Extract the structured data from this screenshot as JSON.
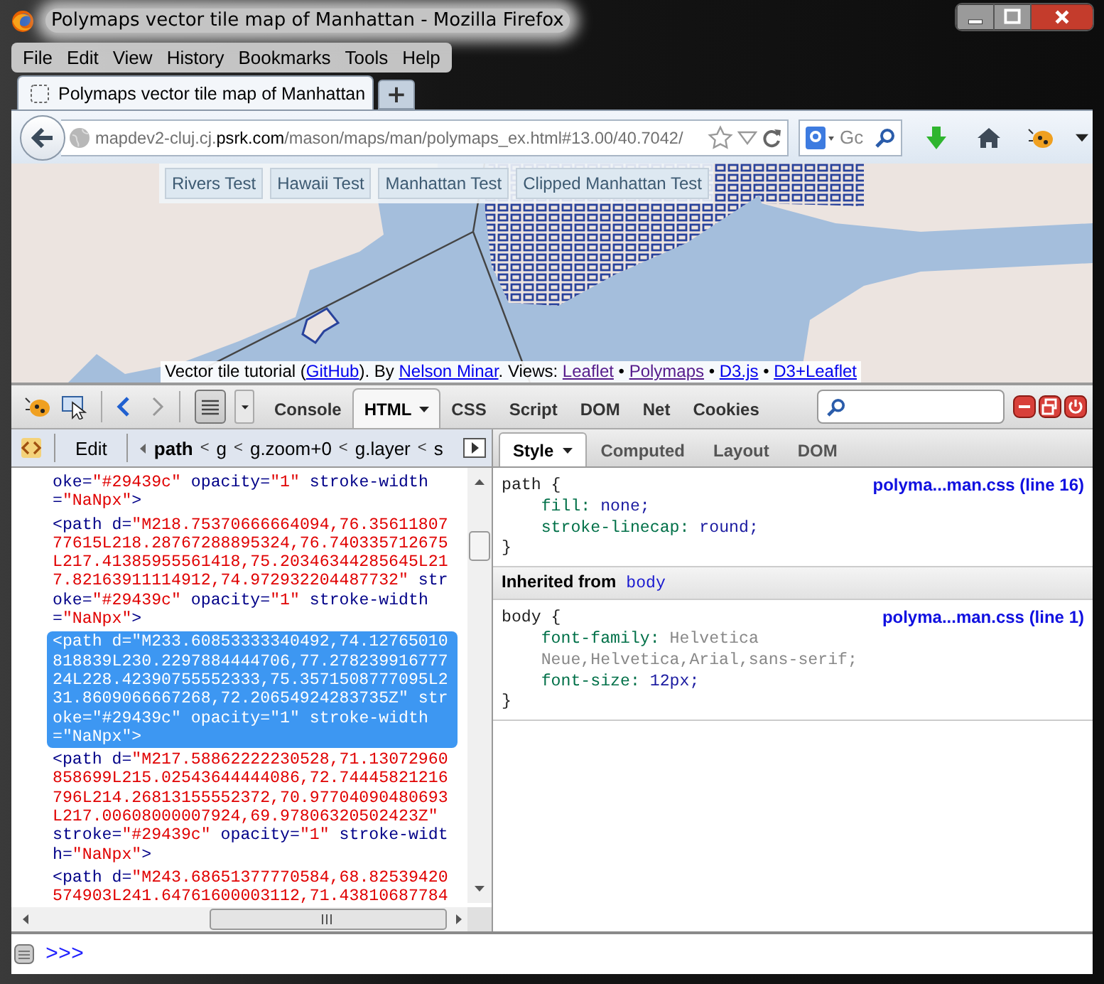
{
  "window": {
    "title": "Polymaps vector tile map of Manhattan - Mozilla Firefox"
  },
  "menu_bar": [
    "File",
    "Edit",
    "View",
    "History",
    "Bookmarks",
    "Tools",
    "Help"
  ],
  "tabs": [
    {
      "label": "Polymaps vector tile map of Manhattan",
      "selected": true
    }
  ],
  "new_tab": "+",
  "address_bar": {
    "url": "mapdev2-cluj.cj.**psrk.com**/mason/maps/man/polymaps_ex.html#13.00/40.7042/"
  },
  "search_bar": {
    "placeholder": "Gc"
  },
  "page": {
    "test_buttons": [
      "Rivers Test",
      "Hawaii Test",
      "Manhattan Test",
      "Clipped Manhattan Test"
    ],
    "attribution": [
      {
        "kind": "text",
        "text": "Vector tile tutorial ("
      },
      {
        "kind": "link",
        "text": "GitHub",
        "visited": false
      },
      {
        "kind": "text",
        "text": "). By "
      },
      {
        "kind": "link",
        "text": "Nelson Minar",
        "visited": false
      },
      {
        "kind": "text",
        "text": ". Views: "
      },
      {
        "kind": "link",
        "text": "Leaflet",
        "visited": true
      },
      {
        "kind": "text",
        "text": " • "
      },
      {
        "kind": "link",
        "text": "Polymaps",
        "visited": true
      },
      {
        "kind": "text",
        "text": " • "
      },
      {
        "kind": "link",
        "text": "D3.js",
        "visited": false
      },
      {
        "kind": "text",
        "text": " • "
      },
      {
        "kind": "link",
        "text": "D3+Leaflet",
        "visited": false
      }
    ]
  },
  "devtools": {
    "panel_tabs": [
      {
        "label": "Console",
        "selected": false,
        "menu": false
      },
      {
        "label": "HTML",
        "selected": true,
        "menu": true
      },
      {
        "label": "CSS",
        "selected": false,
        "menu": false
      },
      {
        "label": "Script",
        "selected": false,
        "menu": false
      },
      {
        "label": "DOM",
        "selected": false,
        "menu": false
      },
      {
        "label": "Net",
        "selected": false,
        "menu": false
      },
      {
        "label": "Cookies",
        "selected": false,
        "menu": false
      }
    ],
    "edit_button": "Edit",
    "breadcrumbs": [
      {
        "kind": "crumb",
        "label": "path",
        "selected": true
      },
      {
        "kind": "separator",
        "label": "<"
      },
      {
        "kind": "crumb",
        "label": "g",
        "selected": false
      },
      {
        "kind": "separator",
        "label": "<"
      },
      {
        "kind": "crumb",
        "label": "g.zoom+0",
        "selected": false
      },
      {
        "kind": "separator",
        "label": "<"
      },
      {
        "kind": "crumb",
        "label": "g.layer",
        "selected": false
      },
      {
        "kind": "separator",
        "label": "<"
      },
      {
        "kind": "crumb",
        "label": "s",
        "selected": false
      }
    ],
    "side_tabs": [
      {
        "label": "Style",
        "selected": true,
        "menu": true
      },
      {
        "label": "Computed",
        "selected": false,
        "menu": false
      },
      {
        "label": "Layout",
        "selected": false,
        "menu": false
      },
      {
        "label": "DOM",
        "selected": false,
        "menu": false
      }
    ],
    "html_nodes": [
      {
        "selected": false,
        "segments": [
          {
            "kind": "markup",
            "text": "oke="
          },
          {
            "kind": "value",
            "text": "\"#29439c\""
          },
          {
            "kind": "markup",
            "text": " opacity="
          },
          {
            "kind": "value",
            "text": "\"1\""
          },
          {
            "kind": "markup",
            "text": " stroke-width="
          },
          {
            "kind": "value",
            "text": "\"NaNpx\""
          },
          {
            "kind": "markup",
            "text": ">"
          }
        ]
      },
      {
        "selected": false,
        "segments": [
          {
            "kind": "markup",
            "text": "<path d="
          },
          {
            "kind": "value",
            "text": "\"M218.75370666664094,76.3561180777615L218.28767288895324,76.740335712675L217.41385955561418,75.20346344285645L217.82163911114912,74.972932204487732\""
          },
          {
            "kind": "markup",
            "text": " stroke="
          },
          {
            "kind": "value",
            "text": "\"#29439c\""
          },
          {
            "kind": "markup",
            "text": " opacity="
          },
          {
            "kind": "value",
            "text": "\"1\""
          },
          {
            "kind": "markup",
            "text": " stroke-width="
          },
          {
            "kind": "value",
            "text": "\"NaNpx\""
          },
          {
            "kind": "markup",
            "text": ">"
          }
        ]
      },
      {
        "selected": true,
        "segments": [
          {
            "kind": "markup",
            "text": "<path d="
          },
          {
            "kind": "value",
            "text": "\"M233.60853333340492,74.12765010818839L230.2297884444706,77.27823991677724L228.42390755552333,75.3571508777095L231.8609066667268,72.20654924283735Z\""
          },
          {
            "kind": "markup",
            "text": " stroke="
          },
          {
            "kind": "value",
            "text": "\"#29439c\""
          },
          {
            "kind": "markup",
            "text": " opacity="
          },
          {
            "kind": "value",
            "text": "\"1\""
          },
          {
            "kind": "markup",
            "text": " stroke-width="
          },
          {
            "kind": "value",
            "text": "\"NaNpx\""
          },
          {
            "kind": "markup",
            "text": ">"
          }
        ]
      },
      {
        "selected": false,
        "segments": [
          {
            "kind": "markup",
            "text": "<path d="
          },
          {
            "kind": "value",
            "text": "\"M217.58862222230528,71.13072960858699L215.02543644444086,72.74445821216796L214.26813155552372,70.97704090480693L217.00608000007924,69.97806320502423Z\""
          },
          {
            "kind": "markup",
            "text": " stroke="
          },
          {
            "kind": "value",
            "text": "\"#29439c\""
          },
          {
            "kind": "markup",
            "text": " opacity="
          },
          {
            "kind": "value",
            "text": "\"1\""
          },
          {
            "kind": "markup",
            "text": " stroke-width="
          },
          {
            "kind": "value",
            "text": "\"NaNpx\""
          },
          {
            "kind": "markup",
            "text": ">"
          }
        ]
      },
      {
        "selected": false,
        "segments": [
          {
            "kind": "markup",
            "text": "<path d="
          },
          {
            "kind": "value",
            "text": "\"M243.68651377770584,68.82539420574903L241.64761600003112,71.43810687784"
          }
        ]
      }
    ],
    "css_sections": [
      {
        "kind": "rule",
        "selector": "path {",
        "source": "polyma...man.css (line 16)",
        "close": "}",
        "declarations": [
          {
            "property": "fill:",
            "value": "none;",
            "greyed": false
          },
          {
            "property": "stroke-linecap:",
            "value": "round;",
            "greyed": false
          }
        ]
      },
      {
        "kind": "inherited",
        "label": "Inherited from",
        "element": "body"
      },
      {
        "kind": "rule",
        "selector": "body {",
        "source": "polyma...man.css (line 1)",
        "close": "}",
        "declarations": [
          {
            "property": "font-family:",
            "value": "Helvetica Neue,Helvetica,Arial,sans-serif;",
            "greyed": true
          },
          {
            "property": "font-size:",
            "value": "12px;",
            "greyed": false
          }
        ]
      }
    ],
    "command_prompt": ">>>"
  }
}
